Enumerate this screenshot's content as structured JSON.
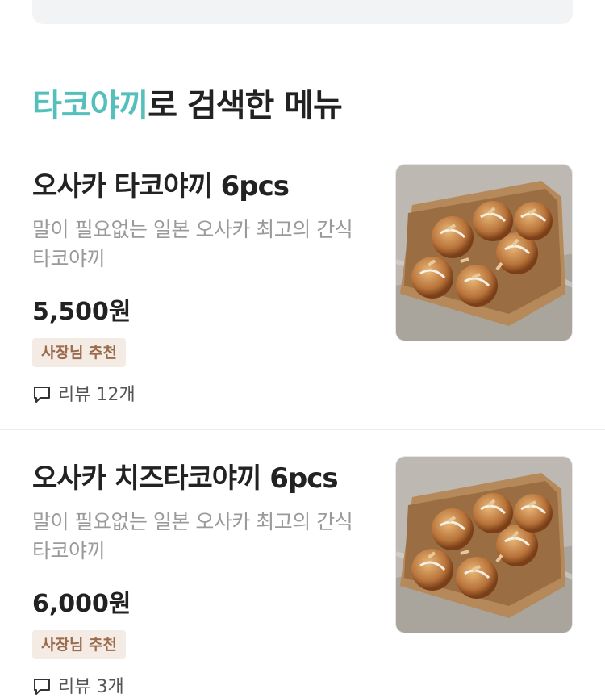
{
  "search": {
    "keyword": "타코야끼",
    "title_suffix": "로 검색한 메뉴"
  },
  "menu_items": [
    {
      "name": "오사카 타코야끼 6pcs",
      "description": "말이 필요없는 일본 오사카 최고의 간식 타코야끼",
      "price": "5,500원",
      "badge": "사장님 추천",
      "reviews": "리뷰 12개",
      "image_icon": "takoyaki-image"
    },
    {
      "name": "오사카 치즈타코야끼 6pcs",
      "description": "말이 필요없는 일본 오사카 최고의 간식 타코야끼",
      "price": "6,000원",
      "badge": "사장님 추천",
      "reviews": "리뷰 3개",
      "image_icon": "takoyaki-image"
    }
  ],
  "colors": {
    "keyword": "#55c0bb",
    "badge_bg": "#f3ebe4",
    "badge_text": "#9b6b4c"
  }
}
